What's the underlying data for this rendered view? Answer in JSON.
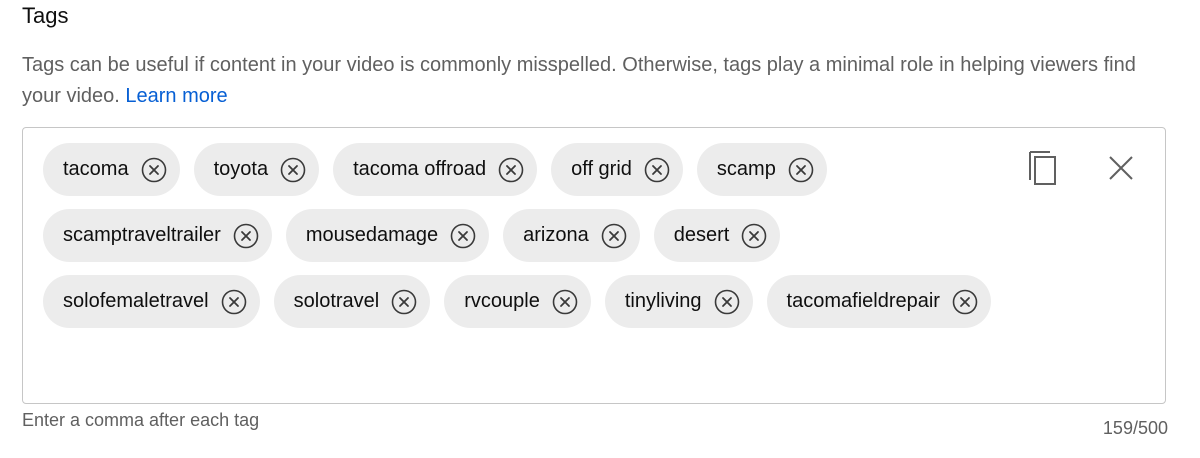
{
  "section": {
    "title": "Tags",
    "description": "Tags can be useful if content in your video is commonly misspelled. Otherwise, tags play a minimal role in helping viewers find your video.",
    "learn_more": "Learn more"
  },
  "tags": [
    {
      "label": "tacoma"
    },
    {
      "label": "toyota"
    },
    {
      "label": "tacoma offroad"
    },
    {
      "label": "off grid"
    },
    {
      "label": "scamp"
    },
    {
      "label": "scamptraveltrailer"
    },
    {
      "label": "mousedamage"
    },
    {
      "label": "arizona"
    },
    {
      "label": "desert"
    },
    {
      "label": "solofemaletravel"
    },
    {
      "label": "solotravel"
    },
    {
      "label": "rvcouple"
    },
    {
      "label": "tinyliving"
    },
    {
      "label": "tacomafieldrepair"
    }
  ],
  "icons": {
    "chip_remove": "close-circle-icon",
    "copy": "copy-icon",
    "clear": "close-icon"
  },
  "footer": {
    "helper": "Enter a comma after each tag",
    "counter": "159/500"
  },
  "colors": {
    "chip_background": "#ececec",
    "link": "#065fd4",
    "secondary_text": "#606060",
    "border": "#c6c6c6"
  }
}
